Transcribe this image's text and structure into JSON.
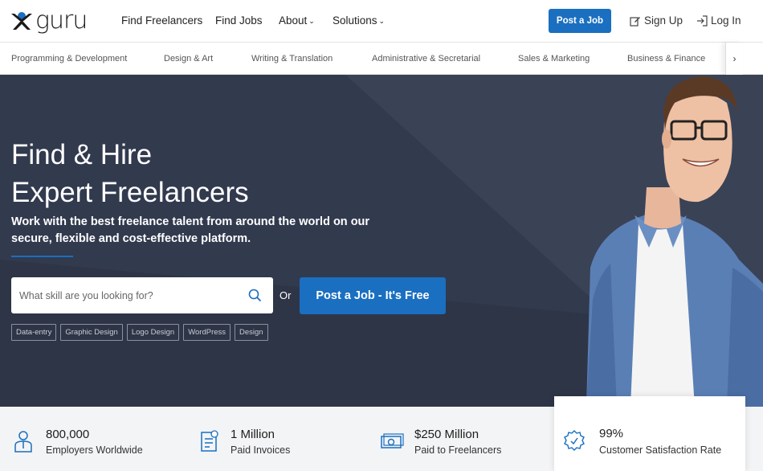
{
  "brand": {
    "logo_text": "guru"
  },
  "nav": {
    "find_freelancers": "Find Freelancers",
    "find_jobs": "Find Jobs",
    "about": "About",
    "solutions": "Solutions",
    "post_job": "Post a Job",
    "sign_up": "Sign Up",
    "log_in": "Log In"
  },
  "categories": [
    "Programming & Development",
    "Design & Art",
    "Writing & Translation",
    "Administrative & Secretarial",
    "Sales & Marketing",
    "Business & Finance"
  ],
  "category_arrow": "›",
  "hero": {
    "title_line1": "Find & Hire",
    "title_line2": "Expert Freelancers",
    "subtitle": "Work with the best freelance talent from around the world on our secure, flexible and cost-effective platform.",
    "search_placeholder": "What skill are you looking for?",
    "or_text": "Or",
    "post_button": "Post a Job - It's Free",
    "tags": [
      "Data-entry",
      "Graphic Design",
      "Logo Design",
      "WordPress",
      "Design"
    ]
  },
  "stats": [
    {
      "value": "800,000",
      "label": "Employers Worldwide",
      "icon": "employer-icon"
    },
    {
      "value": "1 Million",
      "label": "Paid Invoices",
      "icon": "invoice-icon"
    },
    {
      "value": "$250 Million",
      "label": "Paid to Freelancers",
      "icon": "money-icon"
    },
    {
      "value": "99%",
      "label": "Customer Satisfaction Rate",
      "icon": "award-icon"
    }
  ],
  "colors": {
    "primary": "#1a6fc0",
    "hero_bg": "#2e3547",
    "stats_bg": "#f3f4f6"
  }
}
